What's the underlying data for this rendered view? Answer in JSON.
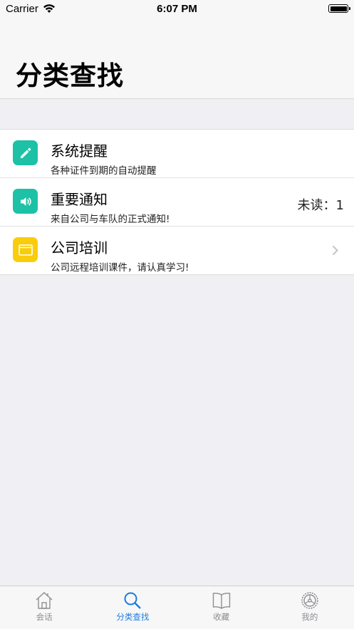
{
  "status_bar": {
    "carrier": "Carrier",
    "time": "6:07 PM",
    "battery_level": 1.0
  },
  "header": {
    "title": "分类查找"
  },
  "list": {
    "items": [
      {
        "title": "系统提醒",
        "subtitle": "各种证件到期的自动提醒",
        "icon": "pencil-icon",
        "icon_color": "#1dc1a6",
        "count_text": ""
      },
      {
        "title": "重要通知",
        "subtitle": "来自公司与车队的正式通知!",
        "icon": "speaker-icon",
        "icon_color": "#1dc1a6",
        "count_text": "未读：1"
      },
      {
        "title": "公司培训",
        "subtitle": "公司远程培训课件，请认真学习!",
        "icon": "window-icon",
        "icon_color": "#f9cd0b",
        "count_text": ""
      }
    ]
  },
  "tabbar": {
    "active_color": "#1a7be0",
    "inactive_color": "#8e8e93",
    "tabs": [
      {
        "label": "会话",
        "icon": "home-icon"
      },
      {
        "label": "分类查找",
        "icon": "search-icon",
        "active": true
      },
      {
        "label": "收藏",
        "icon": "book-icon"
      },
      {
        "label": "我的",
        "icon": "gear-icon"
      }
    ]
  }
}
